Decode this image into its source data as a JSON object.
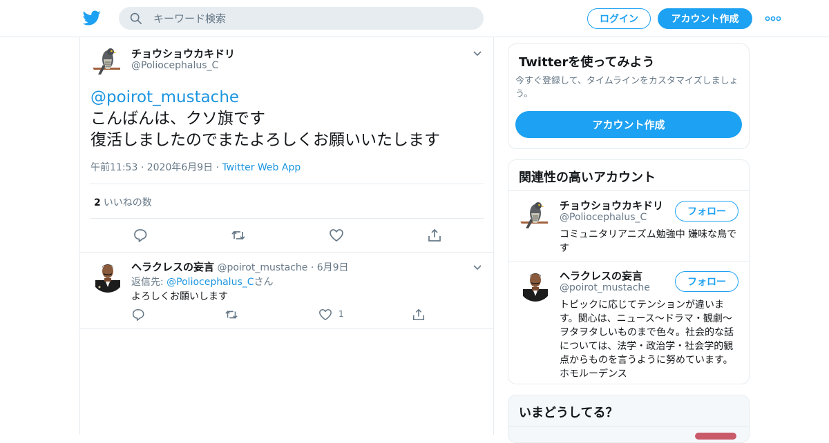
{
  "header": {
    "search_placeholder": "キーワード検索",
    "login_label": "ログイン",
    "signup_label": "アカウント作成"
  },
  "main_tweet": {
    "author_name": "チョウショウカキドリ",
    "author_handle": "@Poliocephalus_C",
    "mention": "@poirot_mustache",
    "line1": "こんばんは、クソ旗です",
    "line2": "復活しましたのでまたよろしくお願いいたします",
    "time": "午前11:53",
    "date": "2020年6月9日",
    "source": "Twitter Web App",
    "likes_count": "2",
    "likes_label": "いいねの数"
  },
  "reply": {
    "author_name": "ヘラクレスの妄言",
    "author_handle": "@poirot_mustache",
    "date": "6月9日",
    "reply_to_prefix": "返信先: ",
    "reply_to_handle": "@Poliocephalus_C",
    "reply_to_suffix": "さん",
    "text": "よろしくお願いします",
    "like_count": "1"
  },
  "signup_card": {
    "title": "Twitterを使ってみよう",
    "subtitle": "今すぐ登録して、タイムラインをカスタマイズしましょう。",
    "button": "アカウント作成"
  },
  "related_card": {
    "title": "関連性の高いアカウント",
    "accounts": [
      {
        "name": "チョウショウカキドリ",
        "handle": "@Poliocephalus_C",
        "bio": "コミュニタリアニズム勉強中 嫌味な鳥です",
        "follow": "フォロー"
      },
      {
        "name": "ヘラクレスの妄言",
        "handle": "@poirot_mustache",
        "bio": "トピックに応じてテンションが違います。関心は、ニュース〜ドラマ・観劇〜ヲタヲタしいものまで色々。社会的な話については、法学・政治学・社会学的観点からものを言うように努めています。ホモルーデンス",
        "follow": "フォロー"
      }
    ]
  },
  "trends_card": {
    "title": "いまどうしてる？"
  },
  "colors": {
    "accent": "#1da1f2",
    "link": "#1b95e0",
    "muted": "#657786",
    "border": "#e6ecf0"
  }
}
